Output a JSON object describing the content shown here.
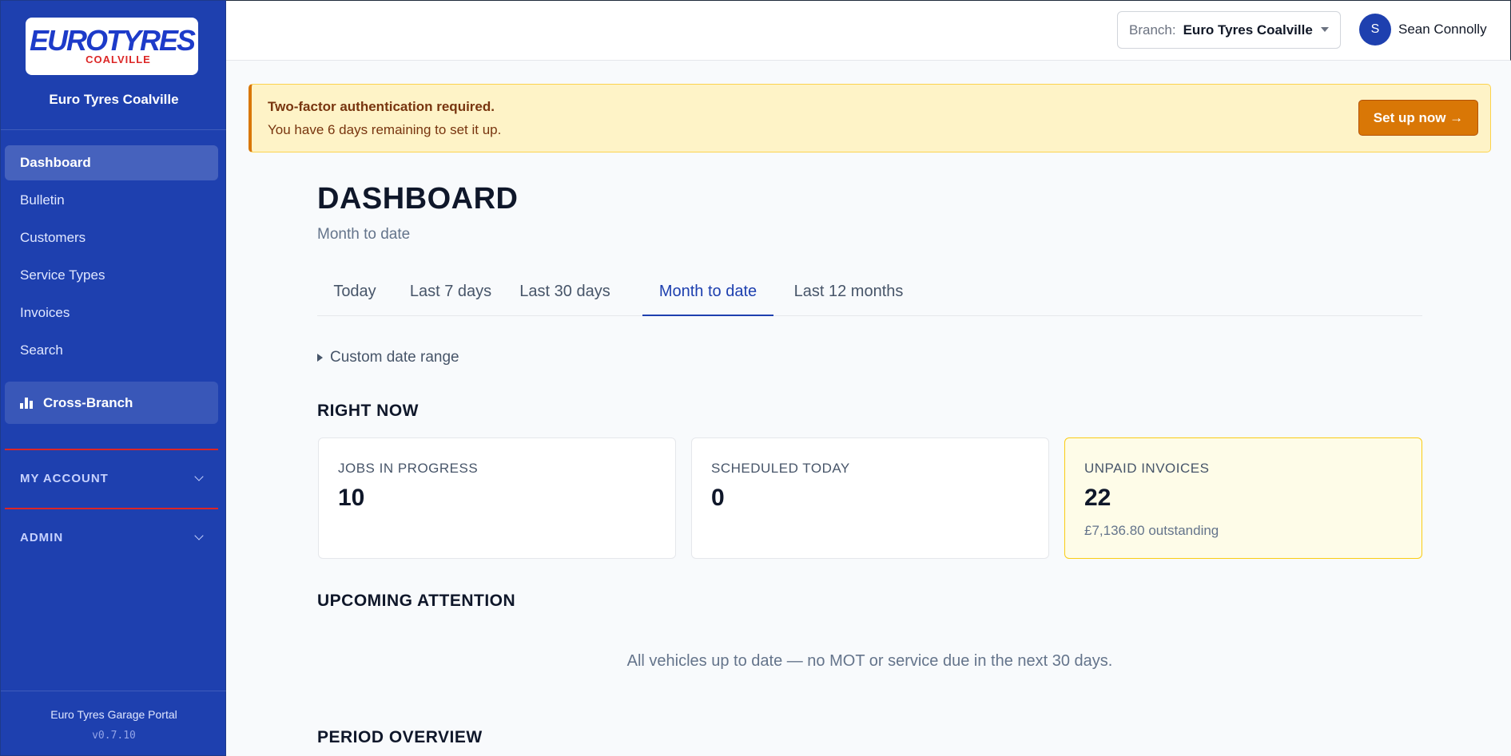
{
  "sidebar": {
    "logo_main": "EUROTYRES",
    "logo_sub": "COALVILLE",
    "branch_name": "Euro Tyres Coalville",
    "items": [
      {
        "label": "Dashboard"
      },
      {
        "label": "Bulletin"
      },
      {
        "label": "Customers"
      },
      {
        "label": "Service Types"
      },
      {
        "label": "Invoices"
      },
      {
        "label": "Search"
      }
    ],
    "cross_branch": "Cross-Branch",
    "my_account": "MY ACCOUNT",
    "admin": "ADMIN",
    "footer": "Euro Tyres Garage Portal",
    "version": "v0.7.10"
  },
  "topbar": {
    "branch_label": "Branch:",
    "branch_value": "Euro Tyres Coalville",
    "avatar_initial": "S",
    "user_name": "Sean Connolly"
  },
  "alert": {
    "title": "Two-factor authentication required.",
    "text": "You have 6 days remaining to set it up.",
    "button": "Set up now →"
  },
  "page": {
    "title": "DASHBOARD",
    "subtitle": "Month to date"
  },
  "tabs": [
    {
      "label": "Today"
    },
    {
      "label": "Last 7 days"
    },
    {
      "label": "Last 30 days"
    },
    {
      "label": "Month to date"
    },
    {
      "label": "Last 12 months"
    }
  ],
  "active_tab": "Month to date",
  "custom_range": "Custom date range",
  "right_now": {
    "title": "RIGHT NOW",
    "cards": [
      {
        "label": "JOBS IN PROGRESS",
        "value": "10"
      },
      {
        "label": "SCHEDULED TODAY",
        "value": "0"
      },
      {
        "label": "UNPAID INVOICES",
        "value": "22",
        "note": "£7,136.80 outstanding"
      }
    ]
  },
  "upcoming": {
    "title": "UPCOMING ATTENTION",
    "message": "All vehicles up to date — no MOT or service due in the next 30 days."
  },
  "period_overview": {
    "title": "PERIOD OVERVIEW"
  },
  "colors": {
    "sidebar": "#1e40af",
    "accent": "#1e40af",
    "warning": "#d97706",
    "danger": "#dc2626"
  }
}
